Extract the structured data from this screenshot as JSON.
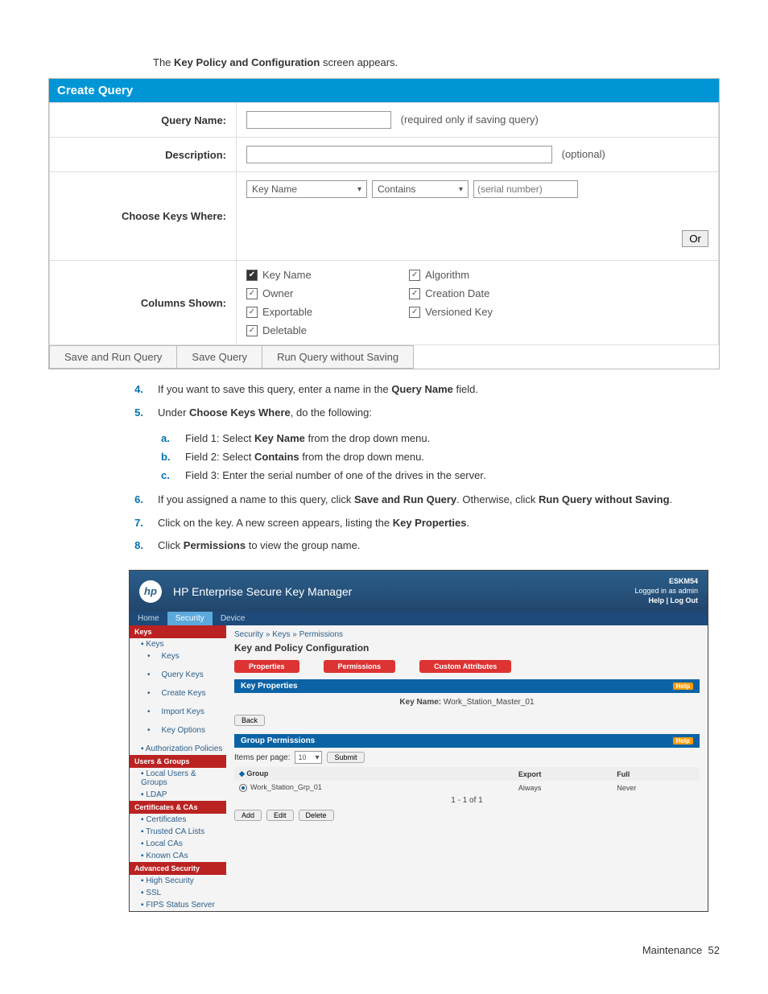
{
  "intro": {
    "prefix": "The ",
    "bold": "Key Policy and Configuration",
    "suffix": " screen appears."
  },
  "createQuery": {
    "title": "Create Query",
    "rows": {
      "queryName": {
        "label": "Query Name:",
        "hint": "(required only if saving query)",
        "value": ""
      },
      "description": {
        "label": "Description:",
        "hint": "(optional)",
        "value": ""
      },
      "chooseKeys": {
        "label": "Choose Keys Where:",
        "field1": "Key Name",
        "field2": "Contains",
        "field3_placeholder": "(serial number)",
        "orLabel": "Or"
      },
      "columnsShown": {
        "label": "Columns Shown:",
        "left": [
          "Key Name",
          "Owner",
          "Exportable",
          "Deletable"
        ],
        "right": [
          "Algorithm",
          "Creation Date",
          "Versioned Key"
        ]
      }
    },
    "footer": [
      "Save and Run Query",
      "Save Query",
      "Run Query without Saving"
    ]
  },
  "steps": {
    "s4": {
      "num": "4.",
      "pre": "If you want to save this query, enter a name in the ",
      "b": "Query Name",
      "post": " field."
    },
    "s5": {
      "num": "5.",
      "pre": "Under ",
      "b": "Choose Keys Where",
      "post": ", do the following:"
    },
    "s5a": {
      "let": "a.",
      "pre": "Field 1: Select ",
      "b": "Key Name",
      "post": " from the drop down menu."
    },
    "s5b": {
      "let": "b.",
      "pre": "Field 2: Select ",
      "b": "Contains",
      "post": " from the drop down menu."
    },
    "s5c": {
      "let": "c.",
      "text": "Field 3: Enter the serial number of one of the drives in the server."
    },
    "s6": {
      "num": "6.",
      "pre": "If you assigned a name to this query, click ",
      "b1": "Save and Run Query",
      "mid": ". Otherwise, click ",
      "b2": "Run Query without Saving",
      "post": "."
    },
    "s7": {
      "num": "7.",
      "pre": "Click on the key. A new screen appears, listing the ",
      "b": "Key Properties",
      "post": "."
    },
    "s8": {
      "num": "8.",
      "pre": "Click ",
      "b": "Permissions",
      "post": " to view the group name."
    }
  },
  "app": {
    "productCode": "ESKM54",
    "loginLine": "Logged in as admin",
    "helpLinks": "Help | Log Out",
    "title": "HP Enterprise Secure Key Manager",
    "tabs": [
      "Home",
      "Security",
      "Device"
    ],
    "sidebar": {
      "sections": [
        {
          "title": "Keys",
          "items": [
            "Keys",
            "Keys",
            "Query Keys",
            "Create Keys",
            "Import Keys",
            "Key Options",
            "Authorization Policies"
          ]
        },
        {
          "title": "Users & Groups",
          "items": [
            "Local Users & Groups",
            "LDAP"
          ]
        },
        {
          "title": "Certificates & CAs",
          "items": [
            "Certificates",
            "Trusted CA Lists",
            "Local CAs",
            "Known CAs"
          ]
        },
        {
          "title": "Advanced Security",
          "items": [
            "High Security",
            "SSL",
            "FIPS Status Server"
          ]
        }
      ]
    },
    "breadcrumbs": "Security » Keys » Permissions",
    "pageHeading": "Key and Policy Configuration",
    "pills": [
      "Properties",
      "Permissions",
      "Custom Attributes"
    ],
    "keyProps": {
      "header": "Key Properties",
      "help": "Help",
      "keyNameLabel": "Key Name:",
      "keyNameValue": "Work_Station_Master_01",
      "back": "Back"
    },
    "groupPerms": {
      "header": "Group Permissions",
      "help": "Help",
      "itemsPerPageLabel": "Items per page:",
      "itemsPerPageValue": "10",
      "submit": "Submit",
      "cols": [
        "Group",
        "Export",
        "Full"
      ],
      "row": {
        "group": "Work_Station_Grp_01",
        "export": "Always",
        "full": "Never"
      },
      "range": "1 - 1 of 1",
      "buttons": [
        "Add",
        "Edit",
        "Delete"
      ]
    }
  },
  "footer": {
    "label": "Maintenance",
    "page": "52"
  }
}
